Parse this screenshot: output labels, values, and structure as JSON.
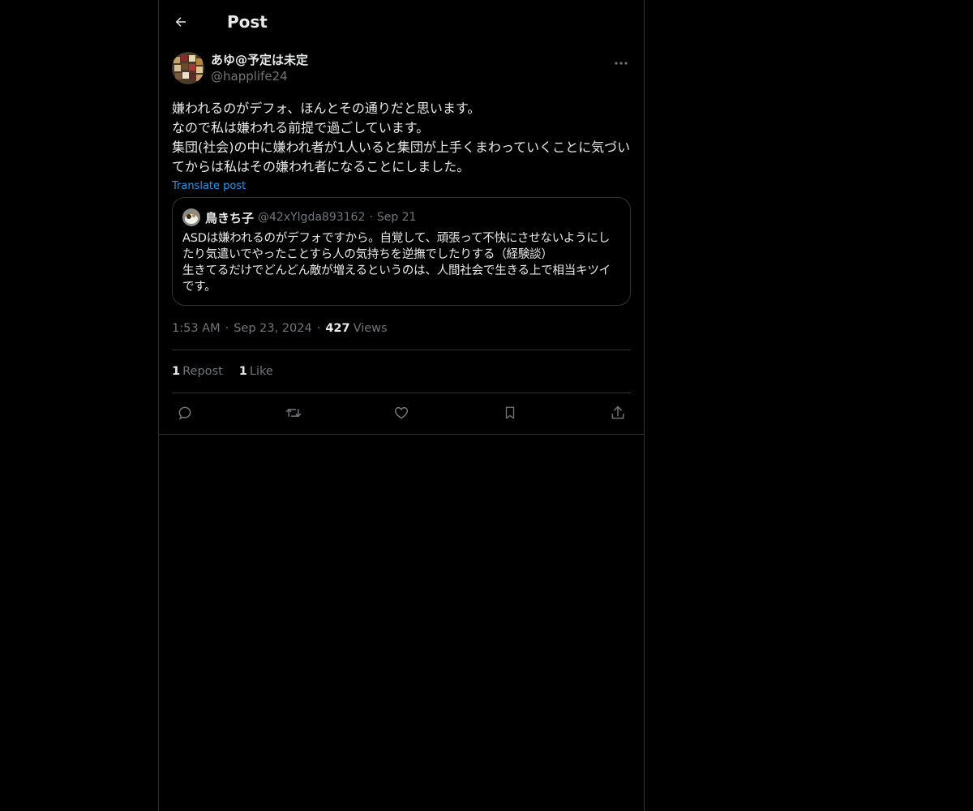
{
  "header": {
    "title": "Post",
    "back_icon": "arrow-left-icon"
  },
  "post": {
    "author": {
      "display_name": "あゆ@予定は未定",
      "handle": "@happlife24"
    },
    "text": "嫌われるのがデフォ、ほんとその通りだと思います。\nなので私は嫌われる前提で過ごしています。\n集団(社会)の中に嫌われ者が1人いると集団が上手くまわっていくことに気づいてからは私はその嫌われ者になることにしました。",
    "translate_label": "Translate post",
    "quote": {
      "display_name": "鳥きち子",
      "handle": "@42xYlgda893162",
      "separator": "·",
      "date": "Sep 21",
      "text": "ASDは嫌われるのがデフォですから。自覚して、頑張って不快にさせないようにしたり気遣いでやったことすら人の気持ちを逆撫でしたりする（経験談）\n生きてるだけでどんどん敵が増えるというのは、人間社会で生きる上で相当キツイです。"
    },
    "time": "1:53 AM",
    "separator": "·",
    "date": "Sep 23, 2024",
    "views_count": "427",
    "views_label": "Views",
    "reposts_count": "1",
    "reposts_label": "Repost",
    "likes_count": "1",
    "likes_label": "Like"
  },
  "actions": [
    "reply-icon",
    "repost-icon",
    "like-icon",
    "bookmark-icon",
    "share-icon"
  ],
  "colors": {
    "background": "#000000",
    "text": "#e7e9ea",
    "muted": "#71767b",
    "accent": "#1d9bf0",
    "border": "#2f3336"
  }
}
